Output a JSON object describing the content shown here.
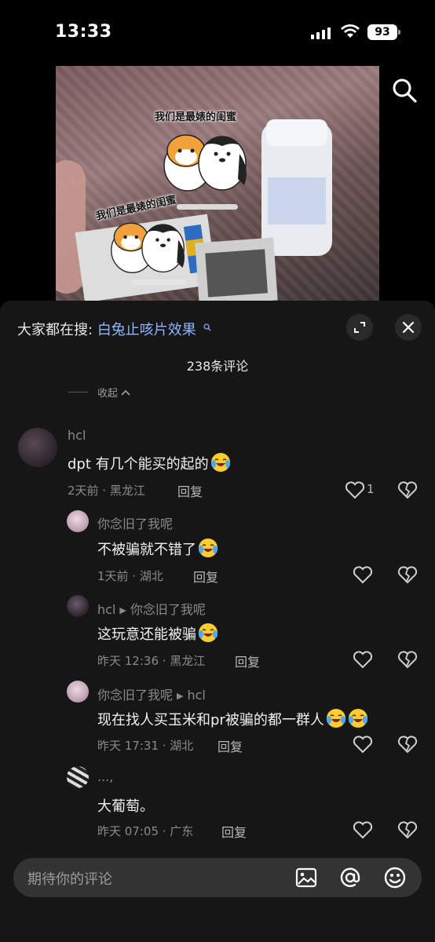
{
  "status_bar": {
    "time": "13:33",
    "battery": "93"
  },
  "video": {
    "caption_top": "我们是最婊的闺蜜",
    "caption_left": "我们是最婊的闺蜜"
  },
  "panel": {
    "hot_search_prefix": "大家都在搜:",
    "hot_search_term": "白兔止咳片效果",
    "comment_count": "238条评论",
    "collapse_label": "收起"
  },
  "comments": [
    {
      "user": "hcl",
      "text": "dpt 有几个能买的起的",
      "meta": "2天前 · 黑龙江",
      "reply": "回复",
      "likes": "1"
    },
    {
      "user": "你念旧了我呢",
      "text": "不被骗就不错了",
      "meta": "1天前 · 湖北",
      "reply": "回复"
    },
    {
      "user": "hcl",
      "reply_to": "你念旧了我呢",
      "text": "这玩意还能被骗",
      "meta": "昨天 12:36 · 黑龙江",
      "reply": "回复"
    },
    {
      "user": "你念旧了我呢",
      "reply_to": "hcl",
      "text": "现在找人买玉米和pr被骗的都一群人",
      "meta": "昨天 17:31 · 湖北",
      "reply": "回复"
    },
    {
      "user": "...,",
      "text": "大葡萄。",
      "meta": "昨天 07:05 · 广东",
      "reply": "回复"
    }
  ],
  "input": {
    "placeholder": "期待你的评论"
  }
}
